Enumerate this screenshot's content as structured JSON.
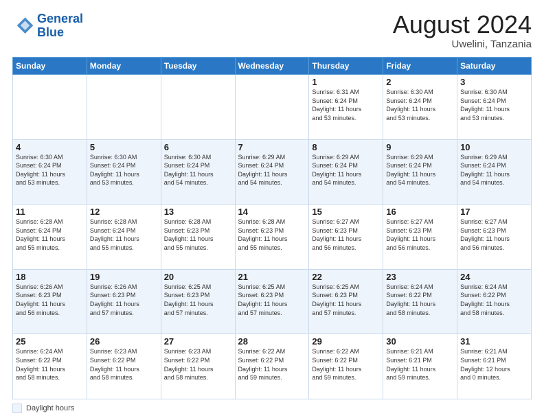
{
  "header": {
    "logo_line1": "General",
    "logo_line2": "Blue",
    "month": "August 2024",
    "location": "Uwelini, Tanzania"
  },
  "days_of_week": [
    "Sunday",
    "Monday",
    "Tuesday",
    "Wednesday",
    "Thursday",
    "Friday",
    "Saturday"
  ],
  "footer_label": "Daylight hours",
  "weeks": [
    [
      {
        "day": "",
        "info": ""
      },
      {
        "day": "",
        "info": ""
      },
      {
        "day": "",
        "info": ""
      },
      {
        "day": "",
        "info": ""
      },
      {
        "day": "1",
        "info": "Sunrise: 6:31 AM\nSunset: 6:24 PM\nDaylight: 11 hours\nand 53 minutes."
      },
      {
        "day": "2",
        "info": "Sunrise: 6:30 AM\nSunset: 6:24 PM\nDaylight: 11 hours\nand 53 minutes."
      },
      {
        "day": "3",
        "info": "Sunrise: 6:30 AM\nSunset: 6:24 PM\nDaylight: 11 hours\nand 53 minutes."
      }
    ],
    [
      {
        "day": "4",
        "info": "Sunrise: 6:30 AM\nSunset: 6:24 PM\nDaylight: 11 hours\nand 53 minutes."
      },
      {
        "day": "5",
        "info": "Sunrise: 6:30 AM\nSunset: 6:24 PM\nDaylight: 11 hours\nand 53 minutes."
      },
      {
        "day": "6",
        "info": "Sunrise: 6:30 AM\nSunset: 6:24 PM\nDaylight: 11 hours\nand 54 minutes."
      },
      {
        "day": "7",
        "info": "Sunrise: 6:29 AM\nSunset: 6:24 PM\nDaylight: 11 hours\nand 54 minutes."
      },
      {
        "day": "8",
        "info": "Sunrise: 6:29 AM\nSunset: 6:24 PM\nDaylight: 11 hours\nand 54 minutes."
      },
      {
        "day": "9",
        "info": "Sunrise: 6:29 AM\nSunset: 6:24 PM\nDaylight: 11 hours\nand 54 minutes."
      },
      {
        "day": "10",
        "info": "Sunrise: 6:29 AM\nSunset: 6:24 PM\nDaylight: 11 hours\nand 54 minutes."
      }
    ],
    [
      {
        "day": "11",
        "info": "Sunrise: 6:28 AM\nSunset: 6:24 PM\nDaylight: 11 hours\nand 55 minutes."
      },
      {
        "day": "12",
        "info": "Sunrise: 6:28 AM\nSunset: 6:24 PM\nDaylight: 11 hours\nand 55 minutes."
      },
      {
        "day": "13",
        "info": "Sunrise: 6:28 AM\nSunset: 6:23 PM\nDaylight: 11 hours\nand 55 minutes."
      },
      {
        "day": "14",
        "info": "Sunrise: 6:28 AM\nSunset: 6:23 PM\nDaylight: 11 hours\nand 55 minutes."
      },
      {
        "day": "15",
        "info": "Sunrise: 6:27 AM\nSunset: 6:23 PM\nDaylight: 11 hours\nand 56 minutes."
      },
      {
        "day": "16",
        "info": "Sunrise: 6:27 AM\nSunset: 6:23 PM\nDaylight: 11 hours\nand 56 minutes."
      },
      {
        "day": "17",
        "info": "Sunrise: 6:27 AM\nSunset: 6:23 PM\nDaylight: 11 hours\nand 56 minutes."
      }
    ],
    [
      {
        "day": "18",
        "info": "Sunrise: 6:26 AM\nSunset: 6:23 PM\nDaylight: 11 hours\nand 56 minutes."
      },
      {
        "day": "19",
        "info": "Sunrise: 6:26 AM\nSunset: 6:23 PM\nDaylight: 11 hours\nand 57 minutes."
      },
      {
        "day": "20",
        "info": "Sunrise: 6:25 AM\nSunset: 6:23 PM\nDaylight: 11 hours\nand 57 minutes."
      },
      {
        "day": "21",
        "info": "Sunrise: 6:25 AM\nSunset: 6:23 PM\nDaylight: 11 hours\nand 57 minutes."
      },
      {
        "day": "22",
        "info": "Sunrise: 6:25 AM\nSunset: 6:23 PM\nDaylight: 11 hours\nand 57 minutes."
      },
      {
        "day": "23",
        "info": "Sunrise: 6:24 AM\nSunset: 6:22 PM\nDaylight: 11 hours\nand 58 minutes."
      },
      {
        "day": "24",
        "info": "Sunrise: 6:24 AM\nSunset: 6:22 PM\nDaylight: 11 hours\nand 58 minutes."
      }
    ],
    [
      {
        "day": "25",
        "info": "Sunrise: 6:24 AM\nSunset: 6:22 PM\nDaylight: 11 hours\nand 58 minutes."
      },
      {
        "day": "26",
        "info": "Sunrise: 6:23 AM\nSunset: 6:22 PM\nDaylight: 11 hours\nand 58 minutes."
      },
      {
        "day": "27",
        "info": "Sunrise: 6:23 AM\nSunset: 6:22 PM\nDaylight: 11 hours\nand 58 minutes."
      },
      {
        "day": "28",
        "info": "Sunrise: 6:22 AM\nSunset: 6:22 PM\nDaylight: 11 hours\nand 59 minutes."
      },
      {
        "day": "29",
        "info": "Sunrise: 6:22 AM\nSunset: 6:22 PM\nDaylight: 11 hours\nand 59 minutes."
      },
      {
        "day": "30",
        "info": "Sunrise: 6:21 AM\nSunset: 6:21 PM\nDaylight: 11 hours\nand 59 minutes."
      },
      {
        "day": "31",
        "info": "Sunrise: 6:21 AM\nSunset: 6:21 PM\nDaylight: 12 hours\nand 0 minutes."
      }
    ]
  ]
}
